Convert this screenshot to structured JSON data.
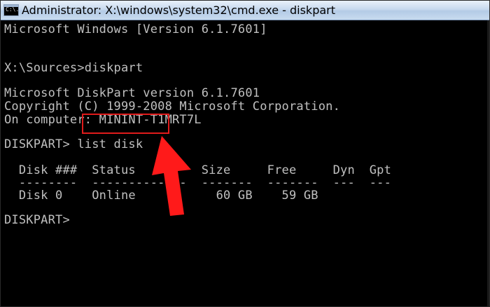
{
  "window": {
    "title": "Administrator: X:\\windows\\system32\\cmd.exe - diskpart",
    "icon_label": "C:\\."
  },
  "console": {
    "lines": [
      "Microsoft Windows [Version 6.1.7601]",
      "X:\\Sources>diskpart",
      "Microsoft DiskPart version 6.1.7601",
      "Copyright (C) 1999-2008 Microsoft Corporation.",
      "On computer: MININT-T1MRT7L",
      "DISKPART> list disk",
      "  Disk ###  Status         Size     Free     Dyn  Gpt",
      "  --------  -------------  -------  -------  ---  ---",
      "  Disk 0    Online           60 GB    59 GB",
      "DISKPART>"
    ]
  },
  "annotation": {
    "highlight_color": "#e01b1b",
    "arrow_color": "#ff1a1a"
  }
}
